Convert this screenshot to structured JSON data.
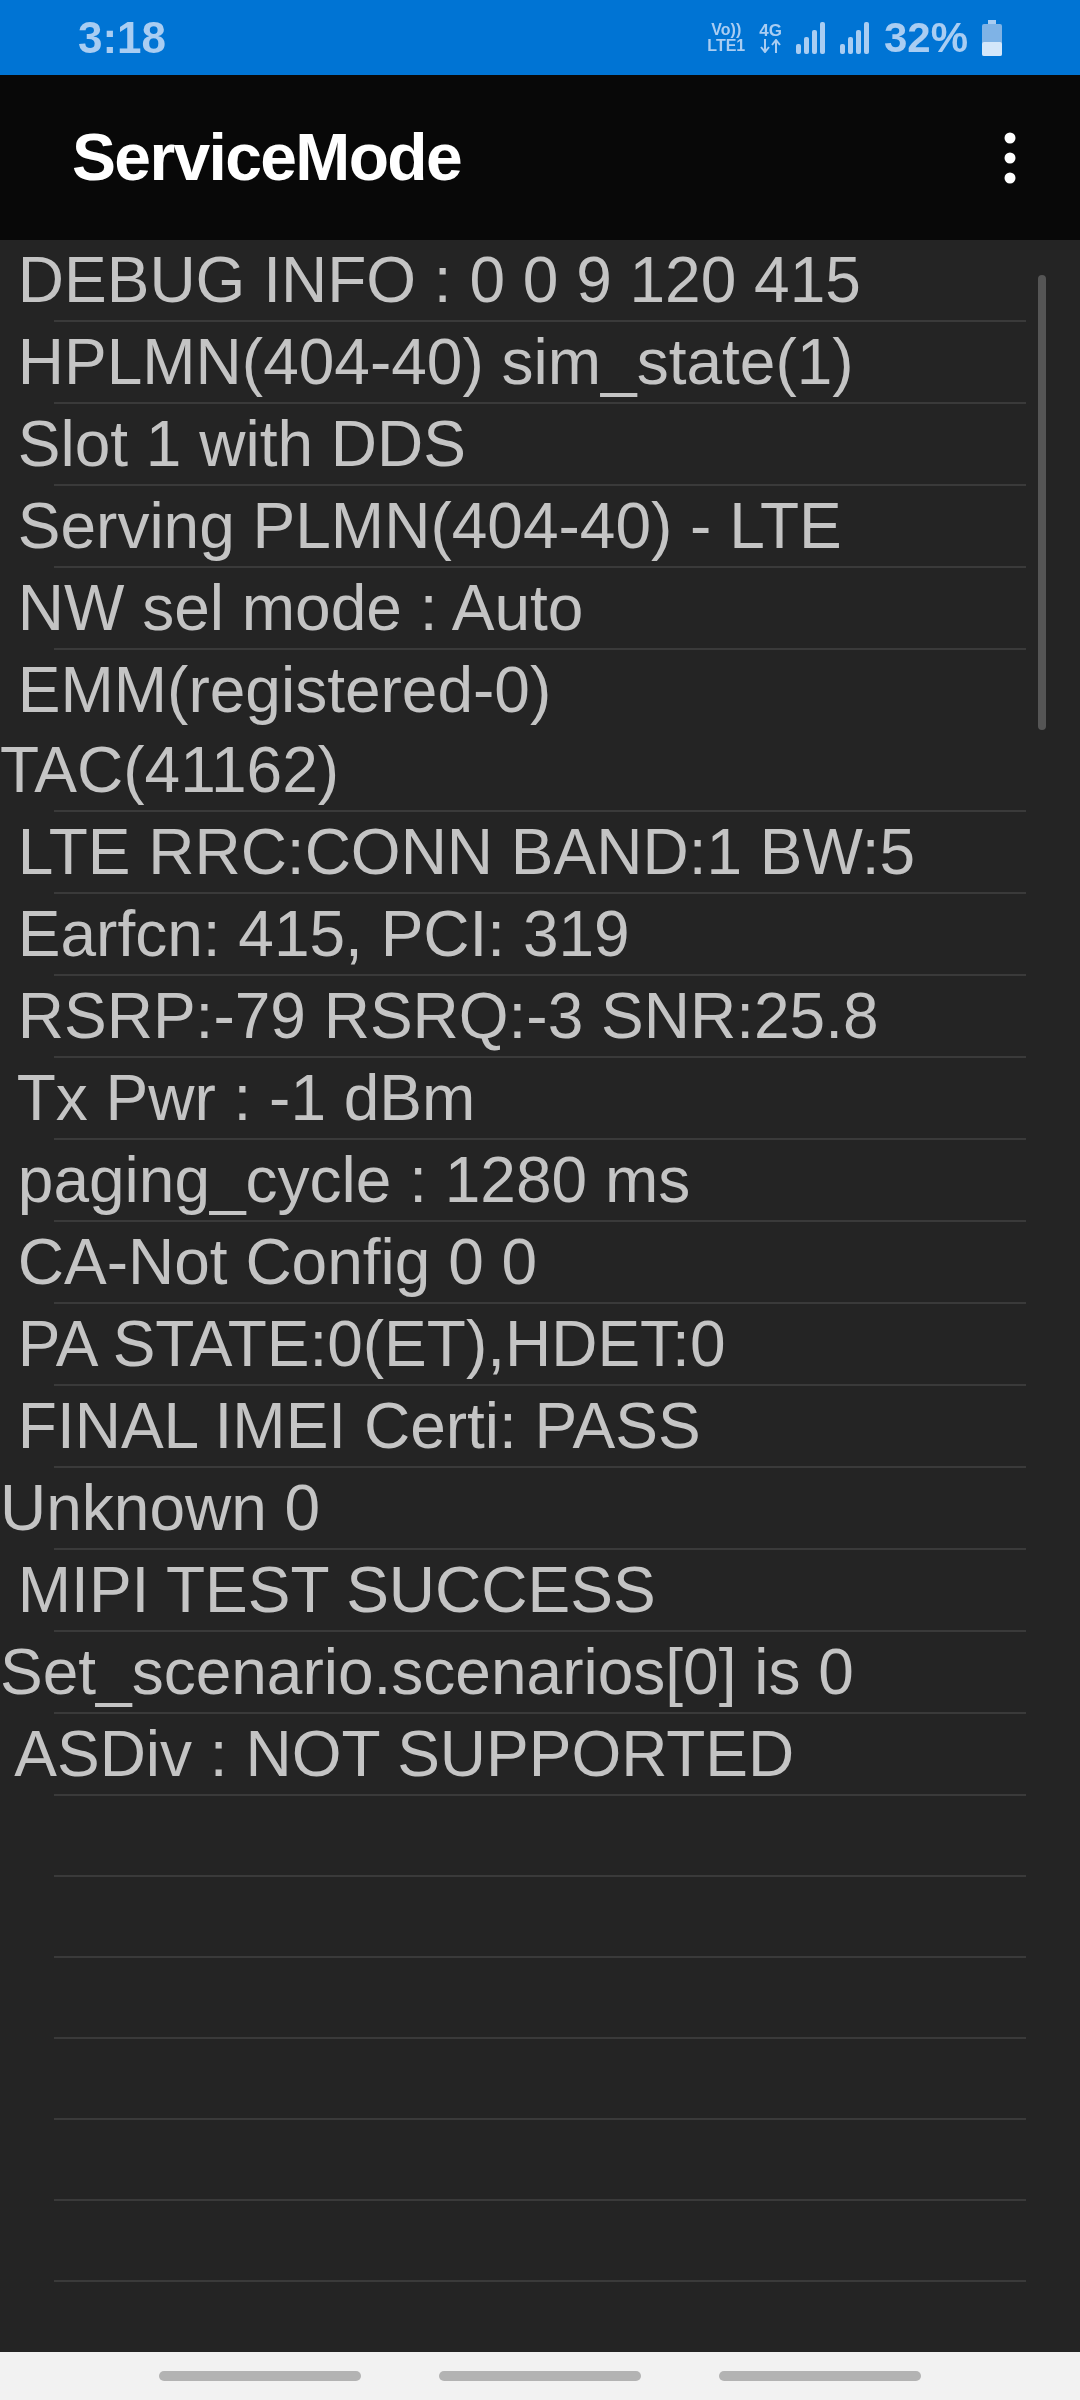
{
  "status_bar": {
    "time": "3:18",
    "volte": "Vo))",
    "volte_sub": "LTE1",
    "network": "4G",
    "battery": "32%"
  },
  "app_bar": {
    "title": "ServiceMode"
  },
  "rows": [
    {
      "lines": [
        " DEBUG INFO : 0 0 9 120 415"
      ]
    },
    {
      "lines": [
        " HPLMN(404-40) sim_state(1)"
      ]
    },
    {
      "lines": [
        " Slot 1 with DDS"
      ]
    },
    {
      "lines": [
        " Serving PLMN(404-40) - LTE"
      ]
    },
    {
      "lines": [
        " NW sel mode : Auto"
      ]
    },
    {
      "lines": [
        " EMM(registered-0)",
        "TAC(41162)"
      ]
    },
    {
      "lines": [
        " LTE RRC:CONN BAND:1 BW:5"
      ]
    },
    {
      "lines": [
        " Earfcn: 415, PCI: 319"
      ]
    },
    {
      "lines": [
        " RSRP:-79 RSRQ:-3 SNR:25.8"
      ]
    },
    {
      "lines": [
        " Tx Pwr : -1 dBm"
      ]
    },
    {
      "lines": [
        " paging_cycle : 1280 ms"
      ]
    },
    {
      "lines": [
        " CA-Not Config 0 0"
      ]
    },
    {
      "lines": [
        " PA STATE:0(ET),HDET:0"
      ]
    },
    {
      "lines": [
        " FINAL IMEI Certi: PASS"
      ]
    },
    {
      "lines": [
        "Unknown 0"
      ]
    },
    {
      "lines": [
        " MIPI TEST SUCCESS"
      ]
    },
    {
      "lines": [
        "Set_scenario.scenarios[0] is 0"
      ]
    },
    {
      "lines": [
        " ASDiv : NOT SUPPORTED"
      ]
    }
  ]
}
